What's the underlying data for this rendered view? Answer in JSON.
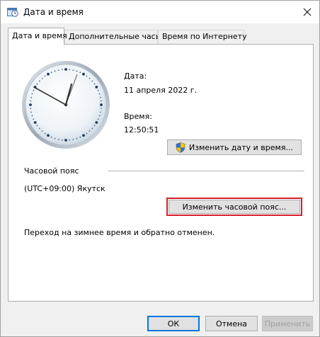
{
  "window": {
    "title": "Дата и время"
  },
  "tabs": [
    {
      "label": "Дата и время",
      "active": true
    },
    {
      "label": "Дополнительные часы",
      "active": false
    },
    {
      "label": "Время по Интернету",
      "active": false
    }
  ],
  "datetime": {
    "date_label": "Дата:",
    "date_value": "11 апреля 2022 г.",
    "time_label": "Время:",
    "time_value": "12:50:51",
    "change_button": "Изменить дату и время..."
  },
  "timezone": {
    "section_label": "Часовой пояс",
    "value": "(UTC+09:00) Якутск",
    "change_button": "Изменить часовой пояс..."
  },
  "dst_note": "Переход на зимнее время и обратно отменен.",
  "footer": {
    "ok": "ОК",
    "cancel": "Отмена",
    "apply": "Применить"
  },
  "colors": {
    "highlight_outline": "#d81e2a",
    "primary_border": "#0078d7"
  },
  "icons": {
    "title": "clock-calendar-icon",
    "close": "close-icon",
    "uac": "uac-shield-icon"
  }
}
